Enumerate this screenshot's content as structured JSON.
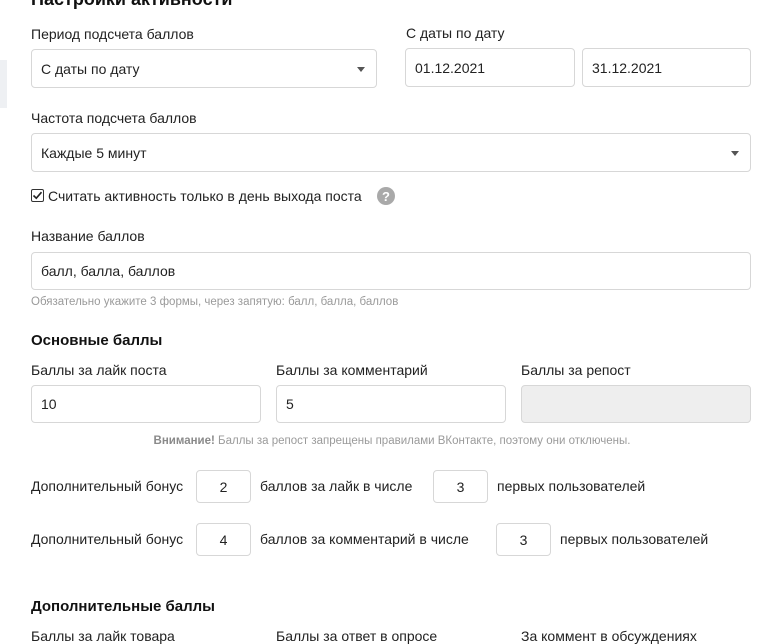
{
  "header": {
    "title": "Настройки активности"
  },
  "period": {
    "label": "Период подсчета баллов",
    "value": "С даты по дату"
  },
  "date_range": {
    "label": "С даты по дату",
    "from": "01.12.2021",
    "to": "31.12.2021"
  },
  "frequency": {
    "label": "Частота подсчета баллов",
    "value": "Каждые 5 минут"
  },
  "only_post_day": {
    "label": "Считать активность только в день выхода поста",
    "checked": true,
    "help": "?"
  },
  "points_name": {
    "label": "Название баллов",
    "value": "балл, балла, баллов",
    "hint": "Обязательно укажите 3 формы, через запятую: балл, балла, баллов"
  },
  "main_points": {
    "title": "Основные баллы",
    "like_label": "Баллы за лайк поста",
    "like_value": "10",
    "comment_label": "Баллы за комментарий",
    "comment_value": "5",
    "repost_label": "Баллы за репост",
    "repost_value": "",
    "note_bold": "Внимание!",
    "note_text": " Баллы за репост запрещены правилами ВКонтакте, поэтому они отключены."
  },
  "bonus_like": {
    "prefix": "Дополнительный бонус",
    "points": "2",
    "middle": "баллов за лайк в числе",
    "count": "3",
    "suffix": "первых пользователей"
  },
  "bonus_comment": {
    "prefix": "Дополнительный бонус",
    "points": "4",
    "middle": "баллов за комментарий в числе",
    "count": "3",
    "suffix": "первых пользователей"
  },
  "extra_points": {
    "title": "Дополнительные баллы",
    "product_like_label": "Баллы за лайк товара",
    "poll_answer_label": "Баллы за ответ в опросе",
    "discussion_comment_label": "За коммент в обсуждениях"
  }
}
